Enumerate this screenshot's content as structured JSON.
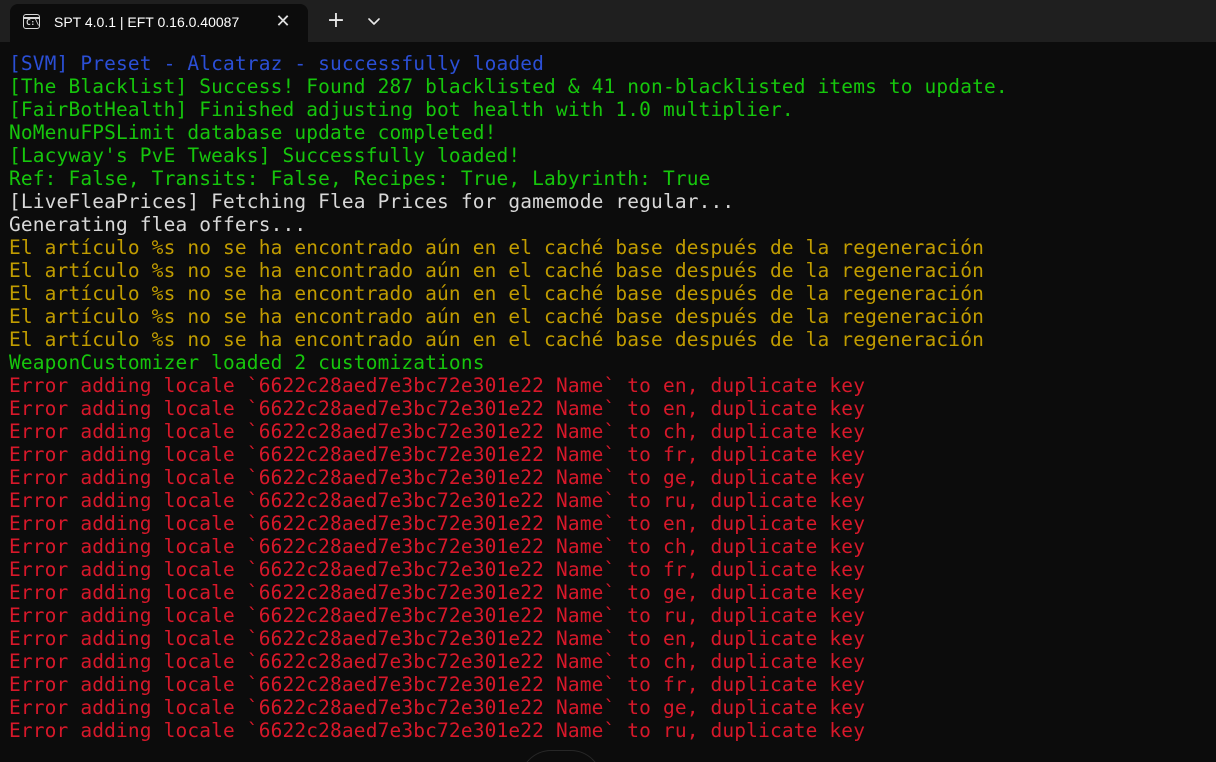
{
  "window": {
    "tab_title": "SPT 4.0.1 | EFT 0.16.0.40087",
    "tab_icon": "terminal-icon",
    "tab_icon_glyph": "C:\\",
    "close_icon": "close-icon",
    "new_tab_label": "+",
    "new_tab_icon": "plus-icon",
    "dropdown_icon": "chevron-down-icon"
  },
  "colors": {
    "background": "#0c0c0c",
    "tabbar": "#1f1f1f",
    "blue": "#2b4fd6",
    "green": "#16c60c",
    "white": "#d8d8d8",
    "yellow": "#c19c00",
    "red": "#d8182a"
  },
  "console": {
    "lines": [
      {
        "text": "[SVM] Preset - Alcatraz - successfully loaded",
        "color": "blue"
      },
      {
        "text": "[The Blacklist] Success! Found 287 blacklisted & 41 non-blacklisted items to update.",
        "color": "green"
      },
      {
        "text": "[FairBotHealth] Finished adjusting bot health with 1.0 multiplier.",
        "color": "green"
      },
      {
        "text": "NoMenuFPSLimit database update completed!",
        "color": "green"
      },
      {
        "text": "[Lacyway's PvE Tweaks] Successfully loaded!",
        "color": "green"
      },
      {
        "text": "Ref: False, Transits: False, Recipes: True, Labyrinth: True",
        "color": "green"
      },
      {
        "text": "[LiveFleaPrices] Fetching Flea Prices for gamemode regular...",
        "color": "white"
      },
      {
        "text": "Generating flea offers...",
        "color": "white"
      },
      {
        "text": "El artículo %s no se ha encontrado aún en el caché base después de la regeneración",
        "color": "yellow"
      },
      {
        "text": "El artículo %s no se ha encontrado aún en el caché base después de la regeneración",
        "color": "yellow"
      },
      {
        "text": "El artículo %s no se ha encontrado aún en el caché base después de la regeneración",
        "color": "yellow"
      },
      {
        "text": "El artículo %s no se ha encontrado aún en el caché base después de la regeneración",
        "color": "yellow"
      },
      {
        "text": "El artículo %s no se ha encontrado aún en el caché base después de la regeneración",
        "color": "yellow"
      },
      {
        "text": "WeaponCustomizer loaded 2 customizations",
        "color": "green"
      },
      {
        "text": "Error adding locale `6622c28aed7e3bc72e301e22 Name` to en, duplicate key",
        "color": "red"
      },
      {
        "text": "Error adding locale `6622c28aed7e3bc72e301e22 Name` to en, duplicate key",
        "color": "red"
      },
      {
        "text": "Error adding locale `6622c28aed7e3bc72e301e22 Name` to ch, duplicate key",
        "color": "red"
      },
      {
        "text": "Error adding locale `6622c28aed7e3bc72e301e22 Name` to fr, duplicate key",
        "color": "red"
      },
      {
        "text": "Error adding locale `6622c28aed7e3bc72e301e22 Name` to ge, duplicate key",
        "color": "red"
      },
      {
        "text": "Error adding locale `6622c28aed7e3bc72e301e22 Name` to ru, duplicate key",
        "color": "red"
      },
      {
        "text": "Error adding locale `6622c28aed7e3bc72e301e22 Name` to en, duplicate key",
        "color": "red"
      },
      {
        "text": "Error adding locale `6622c28aed7e3bc72e301e22 Name` to ch, duplicate key",
        "color": "red"
      },
      {
        "text": "Error adding locale `6622c28aed7e3bc72e301e22 Name` to fr, duplicate key",
        "color": "red"
      },
      {
        "text": "Error adding locale `6622c28aed7e3bc72e301e22 Name` to ge, duplicate key",
        "color": "red"
      },
      {
        "text": "Error adding locale `6622c28aed7e3bc72e301e22 Name` to ru, duplicate key",
        "color": "red"
      },
      {
        "text": "Error adding locale `6622c28aed7e3bc72e301e22 Name` to en, duplicate key",
        "color": "red"
      },
      {
        "text": "Error adding locale `6622c28aed7e3bc72e301e22 Name` to ch, duplicate key",
        "color": "red"
      },
      {
        "text": "Error adding locale `6622c28aed7e3bc72e301e22 Name` to fr, duplicate key",
        "color": "red"
      },
      {
        "text": "Error adding locale `6622c28aed7e3bc72e301e22 Name` to ge, duplicate key",
        "color": "red"
      },
      {
        "text": "Error adding locale `6622c28aed7e3bc72e301e22 Name` to ru, duplicate key",
        "color": "red"
      }
    ]
  }
}
